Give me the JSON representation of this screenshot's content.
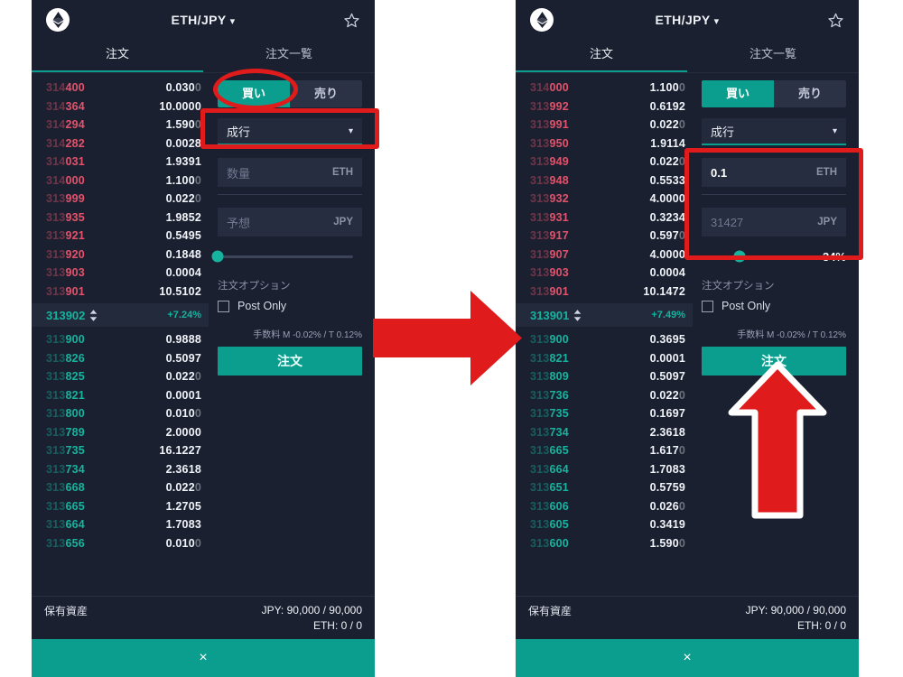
{
  "app": {
    "pair": "ETH/JPY",
    "caret": "▾",
    "coin_icon": "ethereum-icon",
    "star_icon": "star-outline-icon"
  },
  "tabs": [
    {
      "label": "注文",
      "active": true
    },
    {
      "label": "注文一覧",
      "active": false
    }
  ],
  "form": {
    "buy_label": "買い",
    "sell_label": "売り",
    "order_type": "成行",
    "caret": "▾",
    "amount_placeholder": "数量",
    "amount_unit": "ETH",
    "total_placeholder": "予想",
    "total_unit": "JPY",
    "options_label": "注文オプション",
    "post_only_label": "Post Only",
    "fee_text": "手数料 M -0.02% / T 0.12%",
    "submit_label": "注文"
  },
  "footer": {
    "assets_label": "保有資産",
    "jpy_line": "JPY: 90,000 / 90,000",
    "eth_line": "ETH: 0 / 0",
    "close_icon": "×"
  },
  "colors": {
    "accent_teal": "#0b9e8e",
    "bid_green": "#16b39e",
    "ask_red": "#e2536b",
    "annotation_red": "#e01b1b",
    "panel_bg": "#1b2030"
  },
  "left_panel": {
    "amount_value": "",
    "total_value": "",
    "slider_percent": 0,
    "slider_percent_label": "",
    "mid": {
      "price": "313902",
      "change": "+7.24%"
    },
    "asks": [
      {
        "dim": "314",
        "lit": "400",
        "amount": "0.0300",
        "amount_dim": "0"
      },
      {
        "dim": "314",
        "lit": "364",
        "amount": "10.0000",
        "amount_dim": ""
      },
      {
        "dim": "314",
        "lit": "294",
        "amount": "1.5900",
        "amount_dim": "0"
      },
      {
        "dim": "314",
        "lit": "282",
        "amount": "0.0028",
        "amount_dim": ""
      },
      {
        "dim": "314",
        "lit": "031",
        "amount": "1.9391",
        "amount_dim": ""
      },
      {
        "dim": "314",
        "lit": "000",
        "amount": "1.1000",
        "amount_dim": "0"
      },
      {
        "dim": "313",
        "lit": "999",
        "amount": "0.0220",
        "amount_dim": "0"
      },
      {
        "dim": "313",
        "lit": "935",
        "amount": "1.9852",
        "amount_dim": ""
      },
      {
        "dim": "313",
        "lit": "921",
        "amount": "0.5495",
        "amount_dim": ""
      },
      {
        "dim": "313",
        "lit": "920",
        "amount": "0.1848",
        "amount_dim": ""
      },
      {
        "dim": "313",
        "lit": "903",
        "amount": "0.0004",
        "amount_dim": ""
      },
      {
        "dim": "313",
        "lit": "901",
        "amount": "10.5102",
        "amount_dim": ""
      }
    ],
    "bids": [
      {
        "dim": "313",
        "lit": "900",
        "amount": "0.9888",
        "amount_dim": ""
      },
      {
        "dim": "313",
        "lit": "826",
        "amount": "0.5097",
        "amount_dim": ""
      },
      {
        "dim": "313",
        "lit": "825",
        "amount": "0.0220",
        "amount_dim": "0"
      },
      {
        "dim": "313",
        "lit": "821",
        "amount": "0.0001",
        "amount_dim": ""
      },
      {
        "dim": "313",
        "lit": "800",
        "amount": "0.0100",
        "amount_dim": "0"
      },
      {
        "dim": "313",
        "lit": "789",
        "amount": "2.0000",
        "amount_dim": ""
      },
      {
        "dim": "313",
        "lit": "735",
        "amount": "16.1227",
        "amount_dim": ""
      },
      {
        "dim": "313",
        "lit": "734",
        "amount": "2.3618",
        "amount_dim": ""
      },
      {
        "dim": "313",
        "lit": "668",
        "amount": "0.0220",
        "amount_dim": "0"
      },
      {
        "dim": "313",
        "lit": "665",
        "amount": "1.2705",
        "amount_dim": ""
      },
      {
        "dim": "313",
        "lit": "664",
        "amount": "1.7083",
        "amount_dim": ""
      },
      {
        "dim": "313",
        "lit": "656",
        "amount": "0.0100",
        "amount_dim": "0"
      }
    ]
  },
  "right_panel": {
    "amount_value": "0.1",
    "total_value": "31427",
    "slider_percent": 34,
    "slider_percent_label": "34%",
    "mid": {
      "price": "313901",
      "change": "+7.49%"
    },
    "asks": [
      {
        "dim": "314",
        "lit": "000",
        "amount": "1.1000",
        "amount_dim": "0"
      },
      {
        "dim": "313",
        "lit": "992",
        "amount": "0.6192",
        "amount_dim": ""
      },
      {
        "dim": "313",
        "lit": "991",
        "amount": "0.0220",
        "amount_dim": "0"
      },
      {
        "dim": "313",
        "lit": "950",
        "amount": "1.9114",
        "amount_dim": ""
      },
      {
        "dim": "313",
        "lit": "949",
        "amount": "0.0220",
        "amount_dim": "0"
      },
      {
        "dim": "313",
        "lit": "948",
        "amount": "0.5533",
        "amount_dim": ""
      },
      {
        "dim": "313",
        "lit": "932",
        "amount": "4.0000",
        "amount_dim": ""
      },
      {
        "dim": "313",
        "lit": "931",
        "amount": "0.3234",
        "amount_dim": ""
      },
      {
        "dim": "313",
        "lit": "917",
        "amount": "0.5970",
        "amount_dim": "0"
      },
      {
        "dim": "313",
        "lit": "907",
        "amount": "4.0000",
        "amount_dim": ""
      },
      {
        "dim": "313",
        "lit": "903",
        "amount": "0.0004",
        "amount_dim": ""
      },
      {
        "dim": "313",
        "lit": "901",
        "amount": "10.1472",
        "amount_dim": ""
      }
    ],
    "bids": [
      {
        "dim": "313",
        "lit": "900",
        "amount": "0.3695",
        "amount_dim": ""
      },
      {
        "dim": "313",
        "lit": "821",
        "amount": "0.0001",
        "amount_dim": ""
      },
      {
        "dim": "313",
        "lit": "809",
        "amount": "0.5097",
        "amount_dim": ""
      },
      {
        "dim": "313",
        "lit": "736",
        "amount": "0.0220",
        "amount_dim": "0"
      },
      {
        "dim": "313",
        "lit": "735",
        "amount": "0.1697",
        "amount_dim": ""
      },
      {
        "dim": "313",
        "lit": "734",
        "amount": "2.3618",
        "amount_dim": ""
      },
      {
        "dim": "313",
        "lit": "665",
        "amount": "1.6170",
        "amount_dim": "0"
      },
      {
        "dim": "313",
        "lit": "664",
        "amount": "1.7083",
        "amount_dim": ""
      },
      {
        "dim": "313",
        "lit": "651",
        "amount": "0.5759",
        "amount_dim": ""
      },
      {
        "dim": "313",
        "lit": "606",
        "amount": "0.0260",
        "amount_dim": "0"
      },
      {
        "dim": "313",
        "lit": "605",
        "amount": "0.3419",
        "amount_dim": ""
      },
      {
        "dim": "313",
        "lit": "600",
        "amount": "1.5900",
        "amount_dim": "0"
      }
    ]
  },
  "annotations": {
    "buy_tab_ellipse": "red-ellipse-highlight",
    "order_type_rect": "red-rect-highlight",
    "inputs_rect": "red-rect-highlight",
    "transition_arrow": "red-right-arrow",
    "submit_arrow": "red-up-arrow"
  }
}
